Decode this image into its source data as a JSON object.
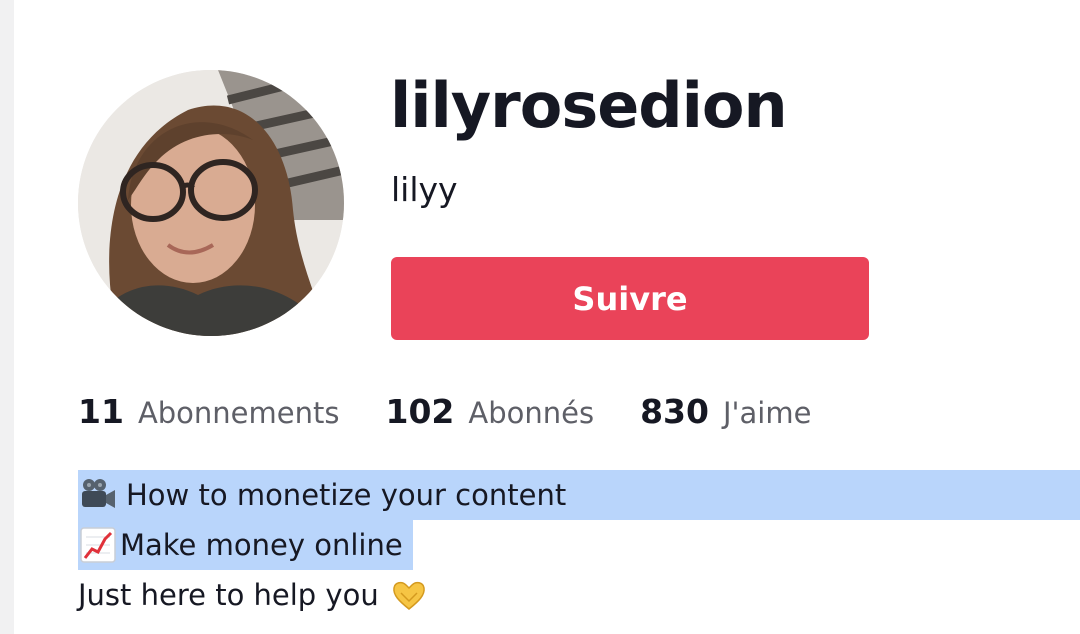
{
  "profile": {
    "username": "lilyrosedion",
    "nickname": "lilyy",
    "follow_label": "Suivre"
  },
  "stats": [
    {
      "value": "11",
      "label": "Abonnements"
    },
    {
      "value": "102",
      "label": "Abonnés"
    },
    {
      "value": "830",
      "label": "J'aime"
    }
  ],
  "bio": {
    "line1": "How to monetize your content",
    "line2": "Make money online",
    "line3": "Just here to help you",
    "line1_icon": "movie-camera-icon",
    "line2_icon": "chart-increasing-icon",
    "line3_icon": "heart-hands-icon"
  },
  "colors": {
    "follow_button": "#ea4359",
    "text_primary": "#161823",
    "text_secondary": "#5e5f67",
    "selection_highlight": "#b9d5fb"
  }
}
